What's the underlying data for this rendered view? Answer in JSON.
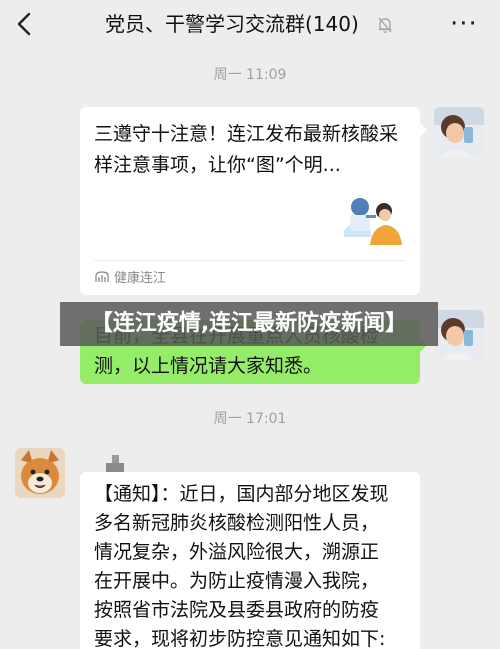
{
  "header": {
    "back_icon": "chevron-left-icon",
    "title": "党员、干警学习交流群(140)",
    "mute_icon": "bell-muted-icon",
    "more_icon": "more-dots-icon",
    "more_glyph": "···"
  },
  "messages": {
    "time_1": "周一 11:09",
    "link_card": {
      "title": "三遵守十注意！连江发布最新核酸采样注意事项，让你“图”个明...",
      "source": "健康连江"
    },
    "green_bubble": {
      "line_1": "目前，全县在开展重点人员核酸检",
      "line_2": "测，以上情况请大家知悉。"
    },
    "time_2": "周一 17:01",
    "notice_text": "【通知】：近日，国内部分地区发现\n多名新冠肺炎核酸检测阳性人员，\n情况复杂，外溢风险很大，溯源正\n在开展中。为防止疫情漫入我院，\n按照省市法院及县委县政府的防疫\n要求，现将初步防控意见通知如下:"
  },
  "banner": {
    "text": "【连江疫情,连江最新防疫新闻】"
  },
  "colors": {
    "background": "#ededed",
    "bubble_green": "#95ec69",
    "bubble_white": "#ffffff",
    "banner": "#5a5a5a"
  }
}
